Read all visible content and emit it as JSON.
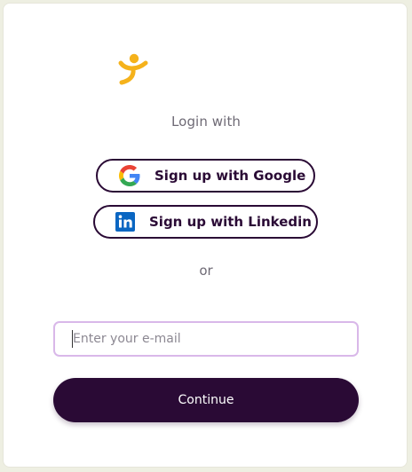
{
  "logo": {
    "icon": "yellow-person-logo-icon",
    "color": "#f5b21b"
  },
  "login_with": "Login with",
  "social": {
    "google": {
      "label": "Sign up with Google",
      "icon": "google-g-icon"
    },
    "linkedin": {
      "label": "Sign up with Linkedin",
      "icon": "linkedin-icon",
      "color": "#0a66c2"
    }
  },
  "or": "or",
  "email": {
    "placeholder": "Enter your e-mail",
    "value": ""
  },
  "continue_label": "Continue",
  "colors": {
    "brand_dark": "#2a0a35",
    "input_border": "#d9b8e9",
    "page_background": "#eeefe2"
  }
}
